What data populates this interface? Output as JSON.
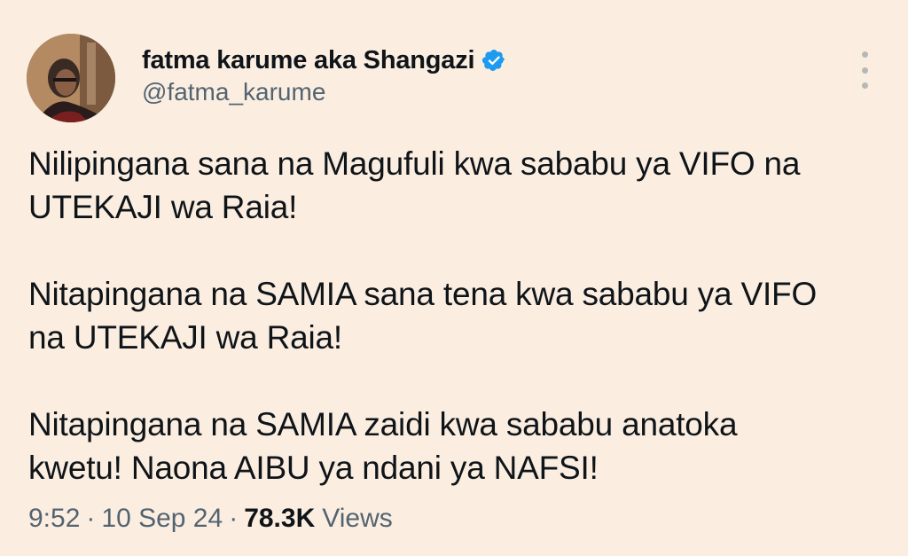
{
  "author": {
    "display_name": "fatma karume aka Shangazi",
    "handle": "@fatma_karume",
    "verified": true
  },
  "tweet": {
    "paragraphs": [
      "Nilipingana sana na Magufuli kwa sababu ya VIFO na\nUTEKAJI wa Raia!",
      "Nitapingana na SAMIA sana tena kwa sababu ya VIFO\nna UTEKAJI wa Raia!",
      "Nitapingana na SAMIA zaidi kwa sababu anatoka\nkwetu! Naona AIBU ya ndani ya NAFSI!"
    ]
  },
  "meta": {
    "time": "9:52",
    "separator": "·",
    "date": "10 Sep 24",
    "views_count": "78.3K",
    "views_label": "Views"
  },
  "icons": {
    "verified": "verified-badge-icon",
    "more": "more-options-icon"
  },
  "colors": {
    "background": "#fbeee1",
    "text": "#0f1419",
    "secondary_text": "#536471",
    "verified_blue": "#1d9bf0"
  }
}
